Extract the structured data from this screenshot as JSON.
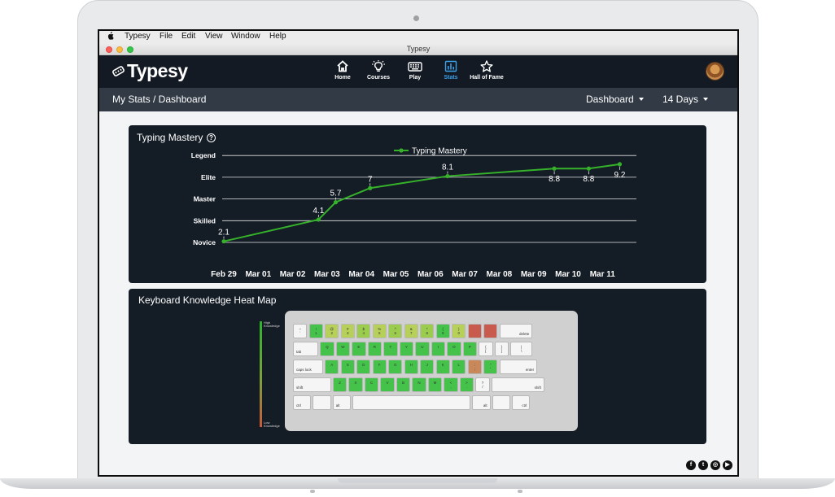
{
  "mac_menu": {
    "items": [
      "Typesy",
      "File",
      "Edit",
      "View",
      "Window",
      "Help"
    ]
  },
  "window": {
    "title": "Typesy"
  },
  "app": {
    "logo": "Typesy",
    "nav": [
      {
        "label": "Home",
        "icon": "home-icon",
        "active": false
      },
      {
        "label": "Courses",
        "icon": "lightbulb-icon",
        "active": false
      },
      {
        "label": "Play",
        "icon": "keyboard-icon",
        "active": false
      },
      {
        "label": "Stats",
        "icon": "bar-chart-icon",
        "active": true
      },
      {
        "label": "Hall of Fame",
        "icon": "star-icon",
        "active": false
      }
    ],
    "active_color": "#3aa0e8"
  },
  "subheader": {
    "breadcrumb": "My Stats / Dashboard",
    "view_select": "Dashboard",
    "range_select": "14 Days"
  },
  "mastery_card": {
    "title": "Typing Mastery"
  },
  "chart_data": {
    "type": "line",
    "title": "",
    "legend": "Typing Mastery",
    "legend_position": "top-center",
    "x_labels": [
      "Feb 29",
      "Mar 01",
      "Mar 02",
      "Mar 03",
      "Mar 04",
      "Mar 05",
      "Mar 06",
      "Mar 07",
      "Mar 08",
      "Mar 09",
      "Mar 10",
      "Mar 11"
    ],
    "y_levels": [
      "Novice",
      "Skilled",
      "Master",
      "Elite",
      "Legend"
    ],
    "ylim": [
      2,
      10
    ],
    "grid": true,
    "series": [
      {
        "name": "Typing Mastery",
        "color": "#35b22a",
        "points": [
          {
            "x": "Feb 29",
            "y": 2.1
          },
          {
            "x": "Mar 02.75",
            "y": 4.1
          },
          {
            "x": "Mar 03.25",
            "y": 5.7
          },
          {
            "x": "Mar 04.25",
            "y": 7
          },
          {
            "x": "Mar 06.5",
            "y": 8.1
          },
          {
            "x": "Mar 09.6",
            "y": 8.8
          },
          {
            "x": "Mar 10.6",
            "y": 8.8
          },
          {
            "x": "Mar 11.5",
            "y": 9.2
          }
        ]
      }
    ]
  },
  "heatmap_card": {
    "title": "Keyboard Knowledge Heat Map",
    "scale_high": "High Knowledge",
    "scale_low": "Low Knowledge"
  },
  "keyboard": {
    "colors": {
      "white": "#f5f5f5",
      "high": "#44c24a",
      "mid": "#9ccc4e",
      "lime": "#b7d05a",
      "orange": "#c8885a",
      "red": "#c95a4e"
    },
    "rows": [
      [
        {
          "l": "~\n`",
          "c": "white",
          "w": 1
        },
        {
          "l": "!\n1",
          "c": "high",
          "w": 1
        },
        {
          "l": "@\n2",
          "c": "lime",
          "w": 1
        },
        {
          "l": "#\n3",
          "c": "lime",
          "w": 1
        },
        {
          "l": "$\n4",
          "c": "mid",
          "w": 1
        },
        {
          "l": "%\n5",
          "c": "lime",
          "w": 1
        },
        {
          "l": "^\n6",
          "c": "mid",
          "w": 1
        },
        {
          "l": "&\n7",
          "c": "lime",
          "w": 1
        },
        {
          "l": "*\n8",
          "c": "mid",
          "w": 1
        },
        {
          "l": "(\n9",
          "c": "high",
          "w": 1
        },
        {
          "l": ")\n0",
          "c": "lime",
          "w": 1
        },
        {
          "l": "",
          "c": "red",
          "w": 1
        },
        {
          "l": "",
          "c": "red",
          "w": 1
        },
        {
          "l": "delete",
          "c": "white",
          "w": 2.2,
          "a": "right"
        }
      ],
      [
        {
          "l": "tab",
          "c": "white",
          "w": 1.7,
          "a": "left"
        },
        {
          "l": "Q",
          "c": "high",
          "w": 1
        },
        {
          "l": "W",
          "c": "high",
          "w": 1
        },
        {
          "l": "E",
          "c": "high",
          "w": 1
        },
        {
          "l": "R",
          "c": "high",
          "w": 1
        },
        {
          "l": "T",
          "c": "high",
          "w": 1
        },
        {
          "l": "Y",
          "c": "high",
          "w": 1
        },
        {
          "l": "U",
          "c": "high",
          "w": 1
        },
        {
          "l": "I",
          "c": "high",
          "w": 1
        },
        {
          "l": "O",
          "c": "high",
          "w": 1
        },
        {
          "l": "P",
          "c": "high",
          "w": 1
        },
        {
          "l": "{\n[",
          "c": "white",
          "w": 1
        },
        {
          "l": "}\n]",
          "c": "white",
          "w": 1
        },
        {
          "l": "|\n\\",
          "c": "white",
          "w": 1.5
        }
      ],
      [
        {
          "l": "caps lock",
          "c": "white",
          "w": 2,
          "a": "left"
        },
        {
          "l": "A",
          "c": "high",
          "w": 1
        },
        {
          "l": "S",
          "c": "high",
          "w": 1
        },
        {
          "l": "D",
          "c": "high",
          "w": 1
        },
        {
          "l": "F",
          "c": "high",
          "w": 1
        },
        {
          "l": "G",
          "c": "high",
          "w": 1
        },
        {
          "l": "H",
          "c": "high",
          "w": 1
        },
        {
          "l": "J",
          "c": "high",
          "w": 1
        },
        {
          "l": "K",
          "c": "high",
          "w": 1
        },
        {
          "l": "L",
          "c": "high",
          "w": 1
        },
        {
          "l": ":\n;",
          "c": "orange",
          "w": 1
        },
        {
          "l": "\"\n'",
          "c": "high",
          "w": 1
        },
        {
          "l": "enter",
          "c": "white",
          "w": 2.5,
          "a": "right"
        }
      ],
      [
        {
          "l": "shift",
          "c": "white",
          "w": 2.5,
          "a": "left"
        },
        {
          "l": "Z",
          "c": "high",
          "w": 1
        },
        {
          "l": "X",
          "c": "high",
          "w": 1
        },
        {
          "l": "C",
          "c": "high",
          "w": 1
        },
        {
          "l": "V",
          "c": "high",
          "w": 1
        },
        {
          "l": "B",
          "c": "high",
          "w": 1
        },
        {
          "l": "N",
          "c": "high",
          "w": 1
        },
        {
          "l": "M",
          "c": "high",
          "w": 1
        },
        {
          "l": "<\n,",
          "c": "high",
          "w": 1
        },
        {
          "l": ">\n.",
          "c": "high",
          "w": 1
        },
        {
          "l": "?\n/",
          "c": "white",
          "w": 1
        },
        {
          "l": "shift",
          "c": "white",
          "w": 3.45,
          "a": "right"
        }
      ],
      [
        {
          "l": "ctrl",
          "c": "white",
          "w": 1.25,
          "a": "left"
        },
        {
          "l": "",
          "c": "white",
          "w": 1.25
        },
        {
          "l": "alt",
          "c": "white",
          "w": 1.25,
          "a": "left"
        },
        {
          "l": "",
          "c": "white",
          "w": 7.55
        },
        {
          "l": "alt",
          "c": "white",
          "w": 1.25,
          "a": "right"
        },
        {
          "l": "",
          "c": "white",
          "w": 1.25
        },
        {
          "l": "ctrl",
          "c": "white",
          "w": 1.25,
          "a": "right"
        }
      ]
    ]
  },
  "social": [
    {
      "icon": "facebook-icon",
      "glyph": "f"
    },
    {
      "icon": "twitter-icon",
      "glyph": "t"
    },
    {
      "icon": "instagram-icon",
      "glyph": "◎"
    },
    {
      "icon": "youtube-icon",
      "glyph": "▶"
    }
  ]
}
